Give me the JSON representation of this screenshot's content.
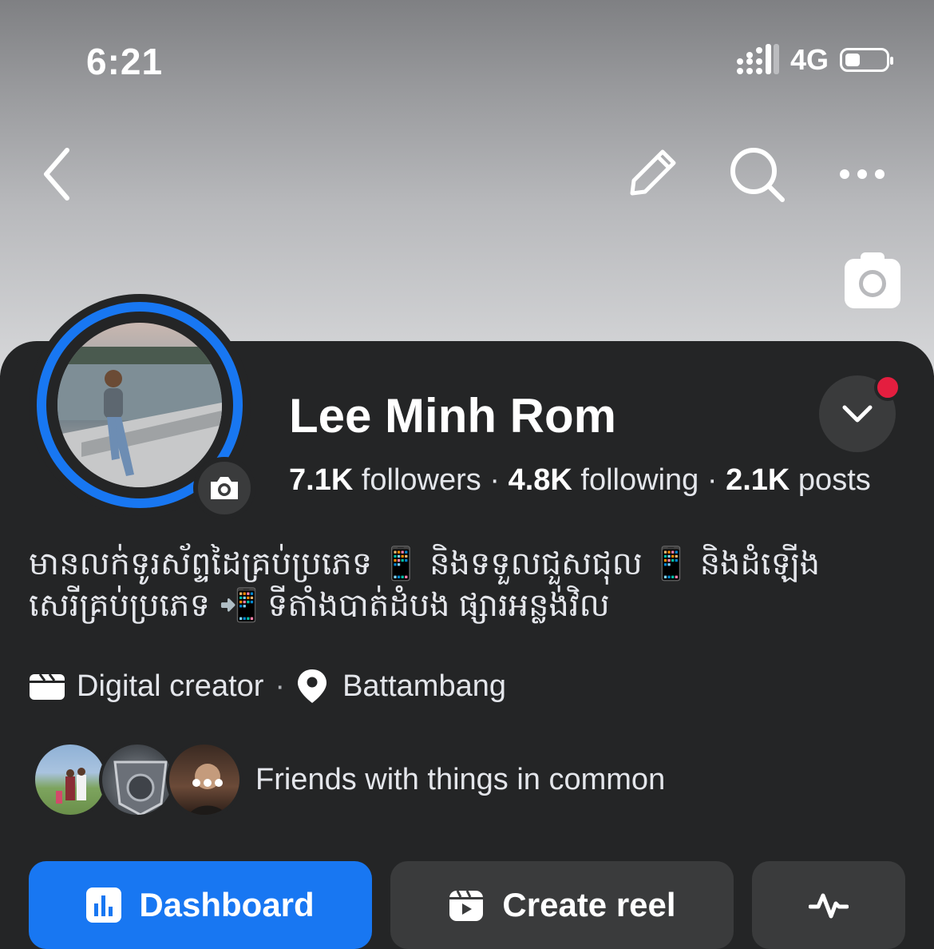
{
  "status": {
    "time": "6:21",
    "network": "4G"
  },
  "profile": {
    "name": "Lee Minh Rom",
    "followers_count": "7.1K",
    "followers_label": "followers",
    "following_count": "4.8K",
    "following_label": "following",
    "posts_count": "2.1K",
    "posts_label": "posts",
    "bio_line1": "មានលក់ទូរស័ព្ទដៃគ្រប់ប្រភេទ 📱 និងទទួលជួសជុល 📱 និងដំឡើង",
    "bio_line2": "សេរីគ្រប់ប្រភេទ 📲 ទីតាំងបាត់ដំបង ផ្សារអន្លង់វិល",
    "category": "Digital creator",
    "separator": "·",
    "location": "Battambang",
    "friends_text": "Friends with things in common"
  },
  "actions": {
    "dashboard_label": "Dashboard",
    "create_reel_label": "Create reel"
  },
  "colors": {
    "accent": "#1877f2",
    "panel": "#242526",
    "button": "#3a3b3c",
    "notify": "#e41e3f"
  },
  "icons": [
    "back-icon",
    "edit-icon",
    "search-icon",
    "more-icon",
    "camera-icon",
    "chevron-down-icon",
    "briefcase-icon",
    "location-pin-icon",
    "dashboard-icon",
    "reel-icon",
    "activity-icon"
  ]
}
